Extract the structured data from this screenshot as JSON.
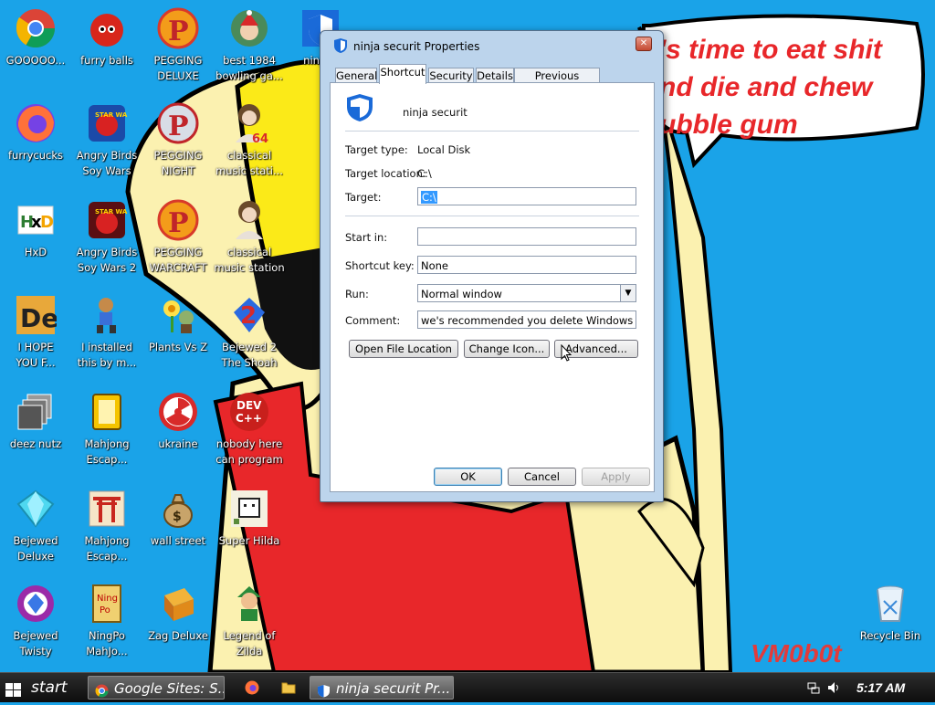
{
  "desktop": {
    "icons": [
      {
        "label": "GOOOOO..."
      },
      {
        "label": "furry balls"
      },
      {
        "label": "PEGGING\nDELUXE"
      },
      {
        "label": "best 1984\nbowling ga..."
      },
      {
        "label": "ninja s"
      },
      {
        "label": "furrycucks"
      },
      {
        "label": "Angry Birds\nSoy Wars"
      },
      {
        "label": "PEGGING\nNIGHT"
      },
      {
        "label": "classical\nmusic stati..."
      },
      {
        "label": "HxD"
      },
      {
        "label": "Angry Birds\nSoy Wars 2"
      },
      {
        "label": "PEGGING\nWARCRAFT"
      },
      {
        "label": "classical\nmusic station"
      },
      {
        "label": "I HOPE\nYOU F..."
      },
      {
        "label": "I installed\nthis by m..."
      },
      {
        "label": "Plants Vs Z"
      },
      {
        "label": "Bejewed 2\nThe Shoah"
      },
      {
        "label": "deez nutz"
      },
      {
        "label": "Mahjong\nEscap..."
      },
      {
        "label": "ukraine"
      },
      {
        "label": "nobody here\ncan program"
      },
      {
        "label": "Bejewed\nDeluxe"
      },
      {
        "label": "Mahjong\nEscap..."
      },
      {
        "label": "wall street"
      },
      {
        "label": "Super Hilda"
      },
      {
        "label": "Bejewed\nTwisty"
      },
      {
        "label": "NingPo\nMahJo..."
      },
      {
        "label": "Zag Deluxe"
      },
      {
        "label": "Legend of\nZilda"
      },
      {
        "label": "Recycle Bin"
      }
    ],
    "wallpaper_text": {
      "speech_lines": [
        "'s time to eat shit",
        "nd die and chew",
        "ubble gum"
      ],
      "watermark": "VM0b0t"
    }
  },
  "window": {
    "title": "ninja securit Properties",
    "tabs": [
      "General",
      "Shortcut",
      "Security",
      "Details",
      "Previous Versions"
    ],
    "active_tab": "Shortcut",
    "shortcut_name": "ninja securit",
    "fields": {
      "target_type_label": "Target type:",
      "target_type_value": "Local Disk",
      "target_location_label": "Target location:",
      "target_location_value": "C:\\",
      "target_label": "Target:",
      "target_value": "C:\\",
      "start_in_label": "Start in:",
      "start_in_value": "",
      "shortcut_key_label": "Shortcut key:",
      "shortcut_key_value": "None",
      "run_label": "Run:",
      "run_value": "Normal window",
      "comment_label": "Comment:",
      "comment_value": "we's recommended you delete Windows Defender"
    },
    "buttons": {
      "open_file_location": "Open File Location",
      "change_icon": "Change Icon...",
      "advanced": "Advanced...",
      "ok": "OK",
      "cancel": "Cancel",
      "apply": "Apply"
    }
  },
  "taskbar": {
    "start_label": "start",
    "items": [
      {
        "label": "Google Sites: S..."
      },
      {
        "label": "ninja securit Pr..."
      }
    ],
    "clock": "5:17 AM"
  },
  "colors": {
    "desktop_bg": "#1aa3e8",
    "wallpaper_red": "#e8272a",
    "skin": "#fbf1b0"
  }
}
